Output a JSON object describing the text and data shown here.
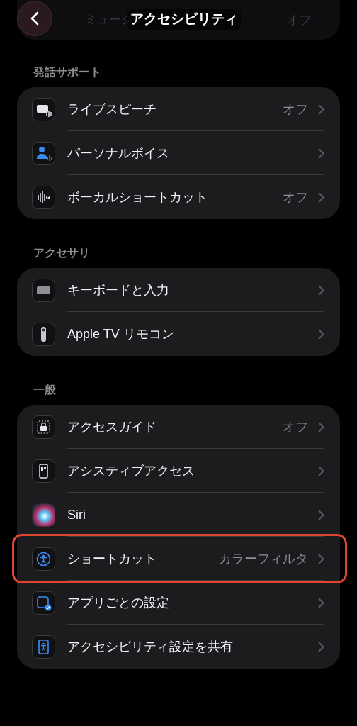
{
  "header": {
    "title": "アクセシビリティ",
    "behind_row": {
      "label": "ミュージ",
      "value": "オフ"
    }
  },
  "groups": [
    {
      "title": "発話サポート",
      "items": [
        {
          "label": "ライブスピーチ",
          "value": "オフ",
          "highlighted": false
        },
        {
          "label": "パーソナルボイス",
          "highlighted": false
        },
        {
          "label": "ボーカルショートカット",
          "value": "オフ",
          "highlighted": false
        }
      ]
    },
    {
      "title": "アクセサリ",
      "items": [
        {
          "label": "キーボードと入力",
          "highlighted": false
        },
        {
          "label": "Apple TV リモコン",
          "highlighted": false
        }
      ]
    },
    {
      "title": "一般",
      "items": [
        {
          "label": "アクセスガイド",
          "value": "オフ",
          "highlighted": false
        },
        {
          "label": "アシスティブアクセス",
          "highlighted": false
        },
        {
          "label": "Siri",
          "highlighted": false
        },
        {
          "label": "ショートカット",
          "value": "カラーフィルタ",
          "highlighted": true
        },
        {
          "label": "アプリごとの設定",
          "highlighted": false
        },
        {
          "label": "アクセシビリティ設定を共有",
          "highlighted": false
        }
      ]
    }
  ]
}
